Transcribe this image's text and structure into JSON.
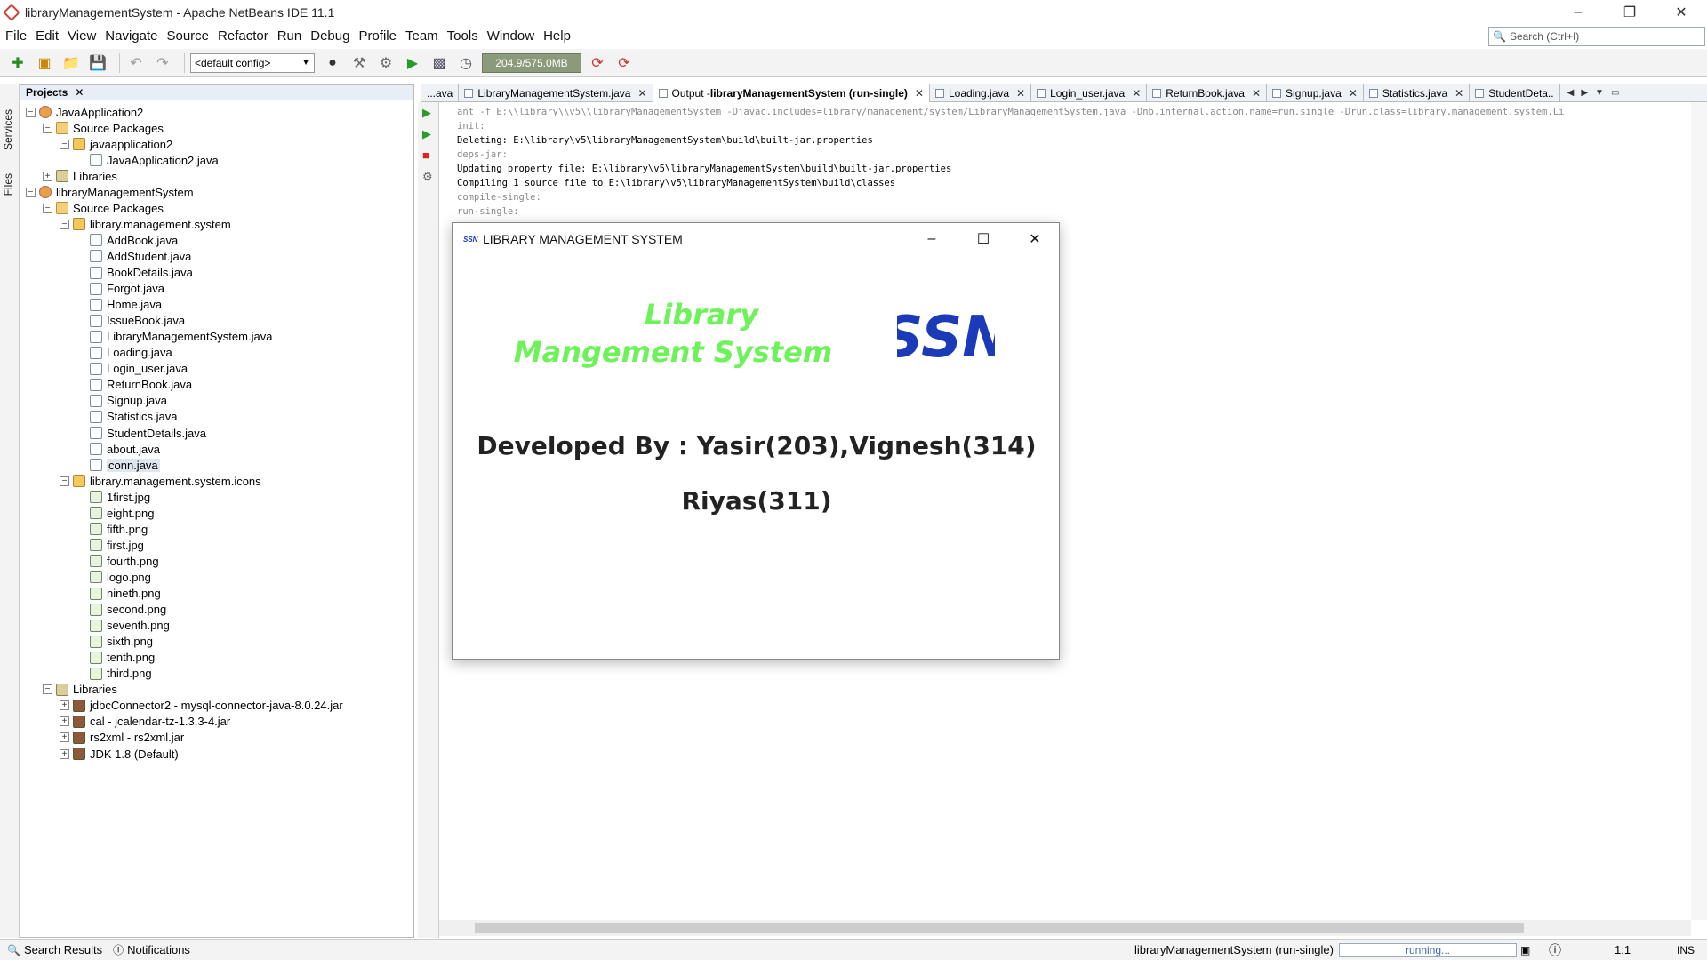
{
  "window": {
    "title": "libraryManagementSystem - Apache NetBeans IDE 11.1"
  },
  "menu": [
    "File",
    "Edit",
    "View",
    "Navigate",
    "Source",
    "Refactor",
    "Run",
    "Debug",
    "Profile",
    "Team",
    "Tools",
    "Window",
    "Help"
  ],
  "search": {
    "placeholder": "Search (Ctrl+I)"
  },
  "toolbar": {
    "config": "<default config>",
    "memory": "204.9/575.0MB"
  },
  "side_labels": {
    "services": "Services",
    "files": "Files"
  },
  "projects": {
    "header": "Projects",
    "tree": [
      {
        "label": "JavaApplication2",
        "icon": "project",
        "level": 0,
        "toggle": "-"
      },
      {
        "label": "Source Packages",
        "icon": "package-folder",
        "level": 1,
        "toggle": "-"
      },
      {
        "label": "javaapplication2",
        "icon": "package",
        "level": 2,
        "toggle": "-"
      },
      {
        "label": "JavaApplication2.java",
        "icon": "java-file",
        "level": 3,
        "toggle": ""
      },
      {
        "label": "Libraries",
        "icon": "library",
        "level": 1,
        "toggle": "+"
      },
      {
        "label": "libraryManagementSystem",
        "icon": "project",
        "level": 0,
        "toggle": "-"
      },
      {
        "label": "Source Packages",
        "icon": "package-folder",
        "level": 1,
        "toggle": "-"
      },
      {
        "label": "library.management.system",
        "icon": "package",
        "level": 2,
        "toggle": "-"
      },
      {
        "label": "AddBook.java",
        "icon": "java-file",
        "level": 3,
        "toggle": ""
      },
      {
        "label": "AddStudent.java",
        "icon": "java-file",
        "level": 3,
        "toggle": ""
      },
      {
        "label": "BookDetails.java",
        "icon": "java-file",
        "level": 3,
        "toggle": ""
      },
      {
        "label": "Forgot.java",
        "icon": "java-file",
        "level": 3,
        "toggle": ""
      },
      {
        "label": "Home.java",
        "icon": "java-file",
        "level": 3,
        "toggle": ""
      },
      {
        "label": "IssueBook.java",
        "icon": "java-file",
        "level": 3,
        "toggle": ""
      },
      {
        "label": "LibraryManagementSystem.java",
        "icon": "java-file",
        "level": 3,
        "toggle": ""
      },
      {
        "label": "Loading.java",
        "icon": "java-file",
        "level": 3,
        "toggle": ""
      },
      {
        "label": "Login_user.java",
        "icon": "java-file",
        "level": 3,
        "toggle": ""
      },
      {
        "label": "ReturnBook.java",
        "icon": "java-file",
        "level": 3,
        "toggle": ""
      },
      {
        "label": "Signup.java",
        "icon": "java-file",
        "level": 3,
        "toggle": ""
      },
      {
        "label": "Statistics.java",
        "icon": "java-file",
        "level": 3,
        "toggle": ""
      },
      {
        "label": "StudentDetails.java",
        "icon": "java-file",
        "level": 3,
        "toggle": ""
      },
      {
        "label": "about.java",
        "icon": "java-file",
        "level": 3,
        "toggle": ""
      },
      {
        "label": "conn.java",
        "icon": "java-file",
        "level": 3,
        "toggle": "",
        "selected": true
      },
      {
        "label": "library.management.system.icons",
        "icon": "package",
        "level": 2,
        "toggle": "-"
      },
      {
        "label": "1first.jpg",
        "icon": "image-file",
        "level": 3,
        "toggle": ""
      },
      {
        "label": "eight.png",
        "icon": "image-file",
        "level": 3,
        "toggle": ""
      },
      {
        "label": "fifth.png",
        "icon": "image-file",
        "level": 3,
        "toggle": ""
      },
      {
        "label": "first.jpg",
        "icon": "image-file",
        "level": 3,
        "toggle": ""
      },
      {
        "label": "fourth.png",
        "icon": "image-file",
        "level": 3,
        "toggle": ""
      },
      {
        "label": "logo.png",
        "icon": "image-file",
        "level": 3,
        "toggle": ""
      },
      {
        "label": "nineth.png",
        "icon": "image-file",
        "level": 3,
        "toggle": ""
      },
      {
        "label": "second.png",
        "icon": "image-file",
        "level": 3,
        "toggle": ""
      },
      {
        "label": "seventh.png",
        "icon": "image-file",
        "level": 3,
        "toggle": ""
      },
      {
        "label": "sixth.png",
        "icon": "image-file",
        "level": 3,
        "toggle": ""
      },
      {
        "label": "tenth.png",
        "icon": "image-file",
        "level": 3,
        "toggle": ""
      },
      {
        "label": "third.png",
        "icon": "image-file",
        "level": 3,
        "toggle": ""
      },
      {
        "label": "Libraries",
        "icon": "library",
        "level": 1,
        "toggle": "-"
      },
      {
        "label": "jdbcConnector2 - mysql-connector-java-8.0.24.jar",
        "icon": "jar",
        "level": 2,
        "toggle": "+"
      },
      {
        "label": "cal - jcalendar-tz-1.3.3-4.jar",
        "icon": "jar",
        "level": 2,
        "toggle": "+"
      },
      {
        "label": "rs2xml - rs2xml.jar",
        "icon": "jar",
        "level": 2,
        "toggle": "+"
      },
      {
        "label": "JDK 1.8 (Default)",
        "icon": "jar",
        "level": 2,
        "toggle": "+"
      }
    ]
  },
  "tabs": [
    {
      "label": "...ava",
      "active": false,
      "closable": false
    },
    {
      "label": "LibraryManagementSystem.java",
      "active": false,
      "closable": true
    },
    {
      "label": "Output - ",
      "bold": "libraryManagementSystem (run-single)",
      "active": true,
      "closable": true
    },
    {
      "label": "Loading.java",
      "active": false,
      "closable": true
    },
    {
      "label": "Login_user.java",
      "active": false,
      "closable": true
    },
    {
      "label": "ReturnBook.java",
      "active": false,
      "closable": true
    },
    {
      "label": "Signup.java",
      "active": false,
      "closable": true
    },
    {
      "label": "Statistics.java",
      "active": false,
      "closable": true
    },
    {
      "label": "StudentDeta..",
      "active": false,
      "closable": false
    }
  ],
  "output_lines": [
    {
      "text": "ant -f E:\\\\library\\\\v5\\\\libraryManagementSystem -Djavac.includes=library/management/system/LibraryManagementSystem.java -Dnb.internal.action.name=run.single -Drun.class=library.management.system.Li",
      "grey": true
    },
    {
      "text": "init:",
      "grey": true
    },
    {
      "text": "Deleting: E:\\library\\v5\\libraryManagementSystem\\build\\built-jar.properties",
      "grey": false
    },
    {
      "text": "deps-jar:",
      "grey": true
    },
    {
      "text": "Updating property file: E:\\library\\v5\\libraryManagementSystem\\build\\built-jar.properties",
      "grey": false
    },
    {
      "text": "Compiling 1 source file to E:\\library\\v5\\libraryManagementSystem\\build\\classes",
      "grey": false
    },
    {
      "text": "compile-single:",
      "grey": true
    },
    {
      "text": "run-single:",
      "grey": true
    }
  ],
  "dialog": {
    "title": "LIBRARY MANAGEMENT SYSTEM",
    "heading_line1": "Library",
    "heading_line2": "Mangement System",
    "logo_text": "SSN",
    "logo_small": "SSN",
    "developed_by": "Developed By : Yasir(203),Vignesh(314)",
    "developed_by2": "Riyas(311)",
    "colors": {
      "heading": "#6ef25a",
      "logo": "#1a3ab8"
    }
  },
  "statusbar": {
    "search_results": "Search Results",
    "notifications": "Notifications",
    "task": "libraryManagementSystem (run-single)",
    "progress_text": "running...",
    "position": "1:1",
    "mode": "INS"
  }
}
